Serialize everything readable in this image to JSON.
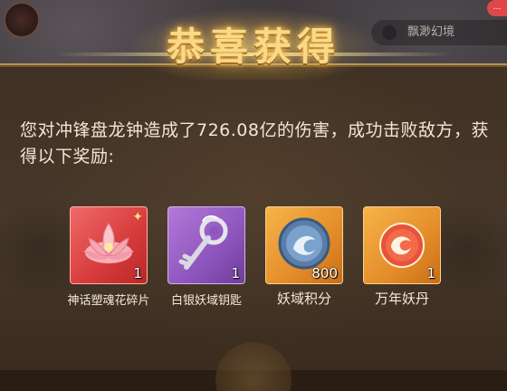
{
  "dialog": {
    "title": "恭喜获得",
    "message": "您对冲锋盘龙钟造成了726.08亿的伤害，成功击败敌方，获得以下奖励:"
  },
  "header": {
    "badge": "...",
    "right_label": "飘渺幻境"
  },
  "rewards": [
    {
      "name": "神话塑魂花碎片",
      "count": "1",
      "icon": "lotus-icon",
      "rarity": "red",
      "color": "#d63a3a"
    },
    {
      "name": "白银妖域钥匙",
      "count": "1",
      "icon": "silver-key-icon",
      "rarity": "purple",
      "color": "#8d55bd"
    },
    {
      "name": "妖域积分",
      "count": "800",
      "icon": "coin-icon",
      "rarity": "orange",
      "color": "#e48d2a"
    },
    {
      "name": "万年妖丹",
      "count": "1",
      "icon": "pill-orb-icon",
      "rarity": "orange",
      "color": "#e48d2a"
    }
  ],
  "colors": {
    "title_gold": "#f8d98a",
    "panel_border": "#b9934f",
    "text": "#f1e7d6"
  }
}
